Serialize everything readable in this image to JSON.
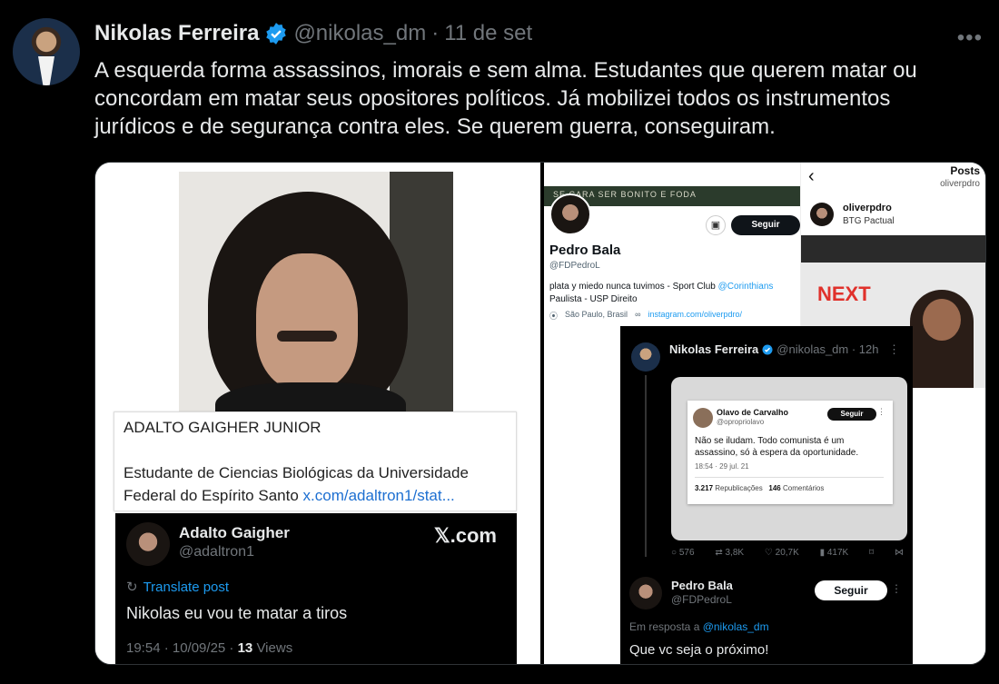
{
  "post": {
    "author_name": "Nikolas Ferreira",
    "author_handle": "@nikolas_dm",
    "separator": "·",
    "date": "11 de set",
    "more": "•••",
    "text": "A esquerda forma assassinos, imorais e sem alma. Estudantes que querem matar ou concordam em matar seus opositores políticos. Já mobilizei todos os instrumentos jurídicos e de segurança contra eles. Se querem guerra, conseguiram."
  },
  "left": {
    "info_name": "ADALTO GAIGHER JUNIOR",
    "info_desc": "Estudante de Ciencias Biológicas da Universidade Federal do Espírito Santo ",
    "info_link": "x.com/adaltron1/stat...",
    "x_name": "Adalto Gaigher",
    "x_handle": "@adaltron1",
    "x_logo": "𝕏.com",
    "translate": "Translate post",
    "x_text": "Nikolas eu vou te matar a tiros",
    "x_time": "19:54 · 10/09/25 · ",
    "x_views_count": "13",
    "x_views_label": " Views"
  },
  "profile": {
    "banner": "SE CARA SER BONITO E FODA",
    "follow": "Seguir",
    "name": "Pedro Bala",
    "handle": "@FDPedroL",
    "bio_pre": "plata y miedo nunca tuvimos - Sport Club ",
    "bio_link": "@Corinthians",
    "bio_post": " Paulista - USP Direito",
    "location": "São Paulo, Brasil",
    "website": "instagram.com/oliverpdro/"
  },
  "instagram": {
    "back": "‹",
    "title": "Posts",
    "user": "oliverpdro",
    "name": "oliverpdro",
    "subtitle": "BTG Pactual",
    "brand": "NEXT"
  },
  "nikolas_post": {
    "name": "Nikolas Ferreira",
    "handle": "@nikolas_dm · 12h",
    "more": "⋮",
    "quoted_name": "Olavo de Carvalho",
    "quoted_handle": "@opropriolavo",
    "quoted_follow": "Seguir",
    "quoted_text": "Não se iludam. Todo comunista é um assassino, só à espera da oportunidade.",
    "quoted_date": "18:54 · 29 jul. 21",
    "reposts_count": "3.217",
    "reposts_label": " Republicações",
    "comments_count": "146",
    "comments_label": " Comentários",
    "replies": "576",
    "retweets": "3,8K",
    "likes": "20,7K",
    "views": "417K"
  },
  "reply": {
    "name": "Pedro Bala",
    "handle": "@FDPedroL",
    "follow": "Seguir",
    "in_reply_to": "Em resposta a ",
    "in_reply_handle": "@nikolas_dm",
    "text": "Que vc seja o próximo!"
  },
  "colors": {
    "background": "#000000",
    "link": "#1d9bf0",
    "verified": "#1d9bf0",
    "muted": "#71767b"
  }
}
